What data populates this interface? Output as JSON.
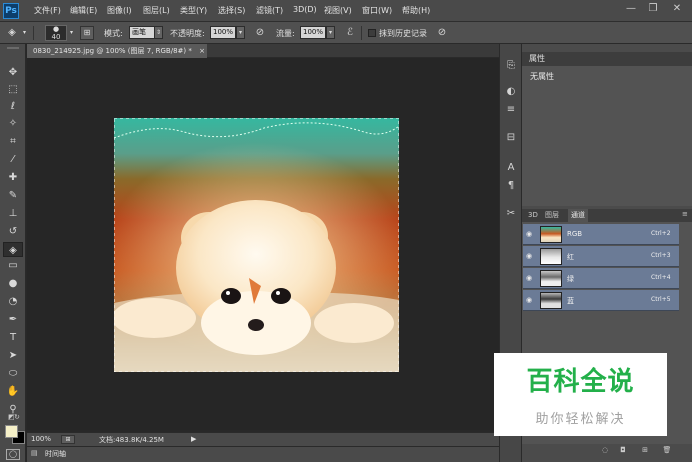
{
  "app": {
    "logo": "Ps"
  },
  "menu": [
    "文件(F)",
    "编辑(E)",
    "图像(I)",
    "图层(L)",
    "类型(Y)",
    "选择(S)",
    "滤镜(T)",
    "3D(D)",
    "视图(V)",
    "窗口(W)",
    "帮助(H)"
  ],
  "window_controls": {
    "minimize": "—",
    "restore": "❐",
    "close": "✕"
  },
  "options": {
    "brush_size": "40",
    "mode_label": "模式:",
    "mode_value": "画笔",
    "opacity_label": "不透明度:",
    "opacity_value": "100%",
    "flow_label": "流量:",
    "flow_value": "100%",
    "erase_history_label": "抹到历史记录"
  },
  "document": {
    "tab_title": "0830_214925.jpg @ 100% (图层 7, RGB/8#) *",
    "tab_close": "×"
  },
  "status": {
    "zoom": "100%",
    "doc_info": "文档:483.8K/4.25M"
  },
  "timeline": {
    "label": "时间轴"
  },
  "tools": [
    {
      "name": "move-tool-icon",
      "glyph": "✥"
    },
    {
      "name": "marquee-tool-icon",
      "glyph": "⬚"
    },
    {
      "name": "lasso-tool-icon",
      "glyph": "ℓ"
    },
    {
      "name": "magic-wand-tool-icon",
      "glyph": "✧"
    },
    {
      "name": "crop-tool-icon",
      "glyph": "⌗"
    },
    {
      "name": "eyedropper-tool-icon",
      "glyph": "⁄"
    },
    {
      "name": "healing-brush-tool-icon",
      "glyph": "✚"
    },
    {
      "name": "brush-tool-icon",
      "glyph": "✎"
    },
    {
      "name": "clone-stamp-tool-icon",
      "glyph": "⊥"
    },
    {
      "name": "history-brush-tool-icon",
      "glyph": "↺"
    },
    {
      "name": "eraser-tool-icon",
      "glyph": "◈"
    },
    {
      "name": "gradient-tool-icon",
      "glyph": "▭"
    },
    {
      "name": "blur-tool-icon",
      "glyph": "●"
    },
    {
      "name": "dodge-tool-icon",
      "glyph": "◔"
    },
    {
      "name": "pen-tool-icon",
      "glyph": "✒"
    },
    {
      "name": "type-tool-icon",
      "glyph": "T"
    },
    {
      "name": "path-selection-tool-icon",
      "glyph": "➤"
    },
    {
      "name": "shape-tool-icon",
      "glyph": "⬭"
    },
    {
      "name": "hand-tool-icon",
      "glyph": "✋"
    },
    {
      "name": "zoom-tool-icon",
      "glyph": "⚲"
    }
  ],
  "colors": {
    "foreground": "#f5f0c8",
    "background": "#000000",
    "selected_row": "#6b7b96",
    "watermark_green": "#23b04a"
  },
  "dock_icons": [
    {
      "name": "history-panel-icon",
      "glyph": "⎘"
    },
    {
      "name": "adjustments-panel-icon",
      "glyph": "◐"
    },
    {
      "name": "properties-panel-icon",
      "glyph": "≡"
    },
    {
      "name": "clone-source-panel-icon",
      "glyph": "⊟"
    },
    {
      "name": "character-panel-icon",
      "glyph": "A"
    },
    {
      "name": "paragraph-panel-icon",
      "glyph": "¶"
    },
    {
      "name": "tool-presets-panel-icon",
      "glyph": "✂"
    }
  ],
  "properties": {
    "title": "属性",
    "empty": "无属性"
  },
  "layer_tabs": [
    "3D",
    "图层",
    "通道"
  ],
  "channels": [
    {
      "name": "RGB",
      "shortcut": "Ctrl+2"
    },
    {
      "name": "红",
      "shortcut": "Ctrl+3"
    },
    {
      "name": "绿",
      "shortcut": "Ctrl+4"
    },
    {
      "name": "蓝",
      "shortcut": "Ctrl+5"
    }
  ],
  "watermark": {
    "title": "百科全说",
    "subtitle": "助你轻松解决"
  }
}
